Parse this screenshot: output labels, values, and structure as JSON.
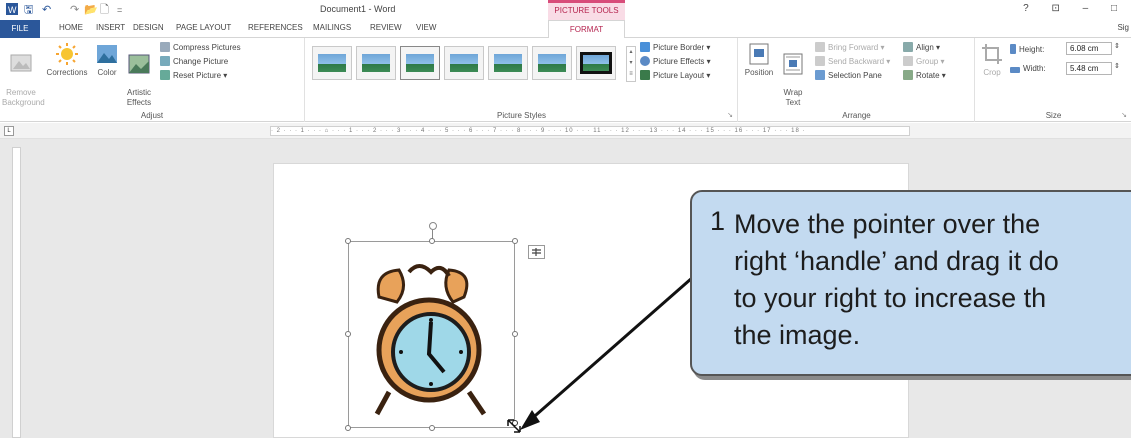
{
  "title_bar": {
    "doc_title": "Document1 - Word",
    "contextual_tab": "PICTURE TOOLS",
    "window_controls": "? ⊡ – □",
    "qat_save": "🖫",
    "qat_undo": "↶",
    "qat_redo": "↷",
    "qat_open": "📂",
    "qat_new": "🗋",
    "qat_more": "="
  },
  "tabs": [
    "FILE",
    "HOME",
    "INSERT",
    "DESIGN",
    "PAGE LAYOUT",
    "REFERENCES",
    "MAILINGS",
    "REVIEW",
    "VIEW",
    "FORMAT"
  ],
  "sign_in": "Sig",
  "ribbon": {
    "adjust": {
      "label": "Adjust",
      "remove_background": "Remove\nBackground",
      "corrections": "Corrections",
      "color": "Color",
      "artistic_effects": "Artistic\nEffects",
      "compress_pictures": "Compress Pictures",
      "change_picture": "Change Picture",
      "reset_picture": "Reset Picture"
    },
    "picture_styles": {
      "label": "Picture Styles",
      "border": "Picture Border",
      "effects": "Picture Effects",
      "layout": "Picture Layout"
    },
    "arrange": {
      "label": "Arrange",
      "position": "Position",
      "wrap_text": "Wrap\nText",
      "bring_forward": "Bring Forward",
      "send_backward": "Send Backward",
      "selection_pane": "Selection Pane",
      "align": "Align",
      "group": "Group",
      "rotate": "Rotate"
    },
    "size": {
      "label": "Size",
      "crop": "Crop",
      "height_label": "Height:",
      "height_value": "6.08 cm",
      "width_label": "Width:",
      "width_value": "5.48 cm"
    }
  },
  "ruler": {
    "corner": "L",
    "marks": "· 2 · · · 1 · · · ⌂ · · · 1 · · · 2 · · · 3 · · · 4 · · · 5 · · · 6 · · · 7 · · · 8 · · · 9 · · · 10 · · · 11 · · · 12 · · · 13 · · · 14 · · · 15 · · · 16 · · · 17 · · · 18 ·"
  },
  "callout": {
    "number": "1",
    "text": "Move the pointer over the\nright ‘handle’ and drag it do\nto your right to increase th\nthe image."
  },
  "colors": {
    "accent": "#2b579a",
    "picture_tools": "#b5244f",
    "callout_bg": "#c3daf0"
  }
}
